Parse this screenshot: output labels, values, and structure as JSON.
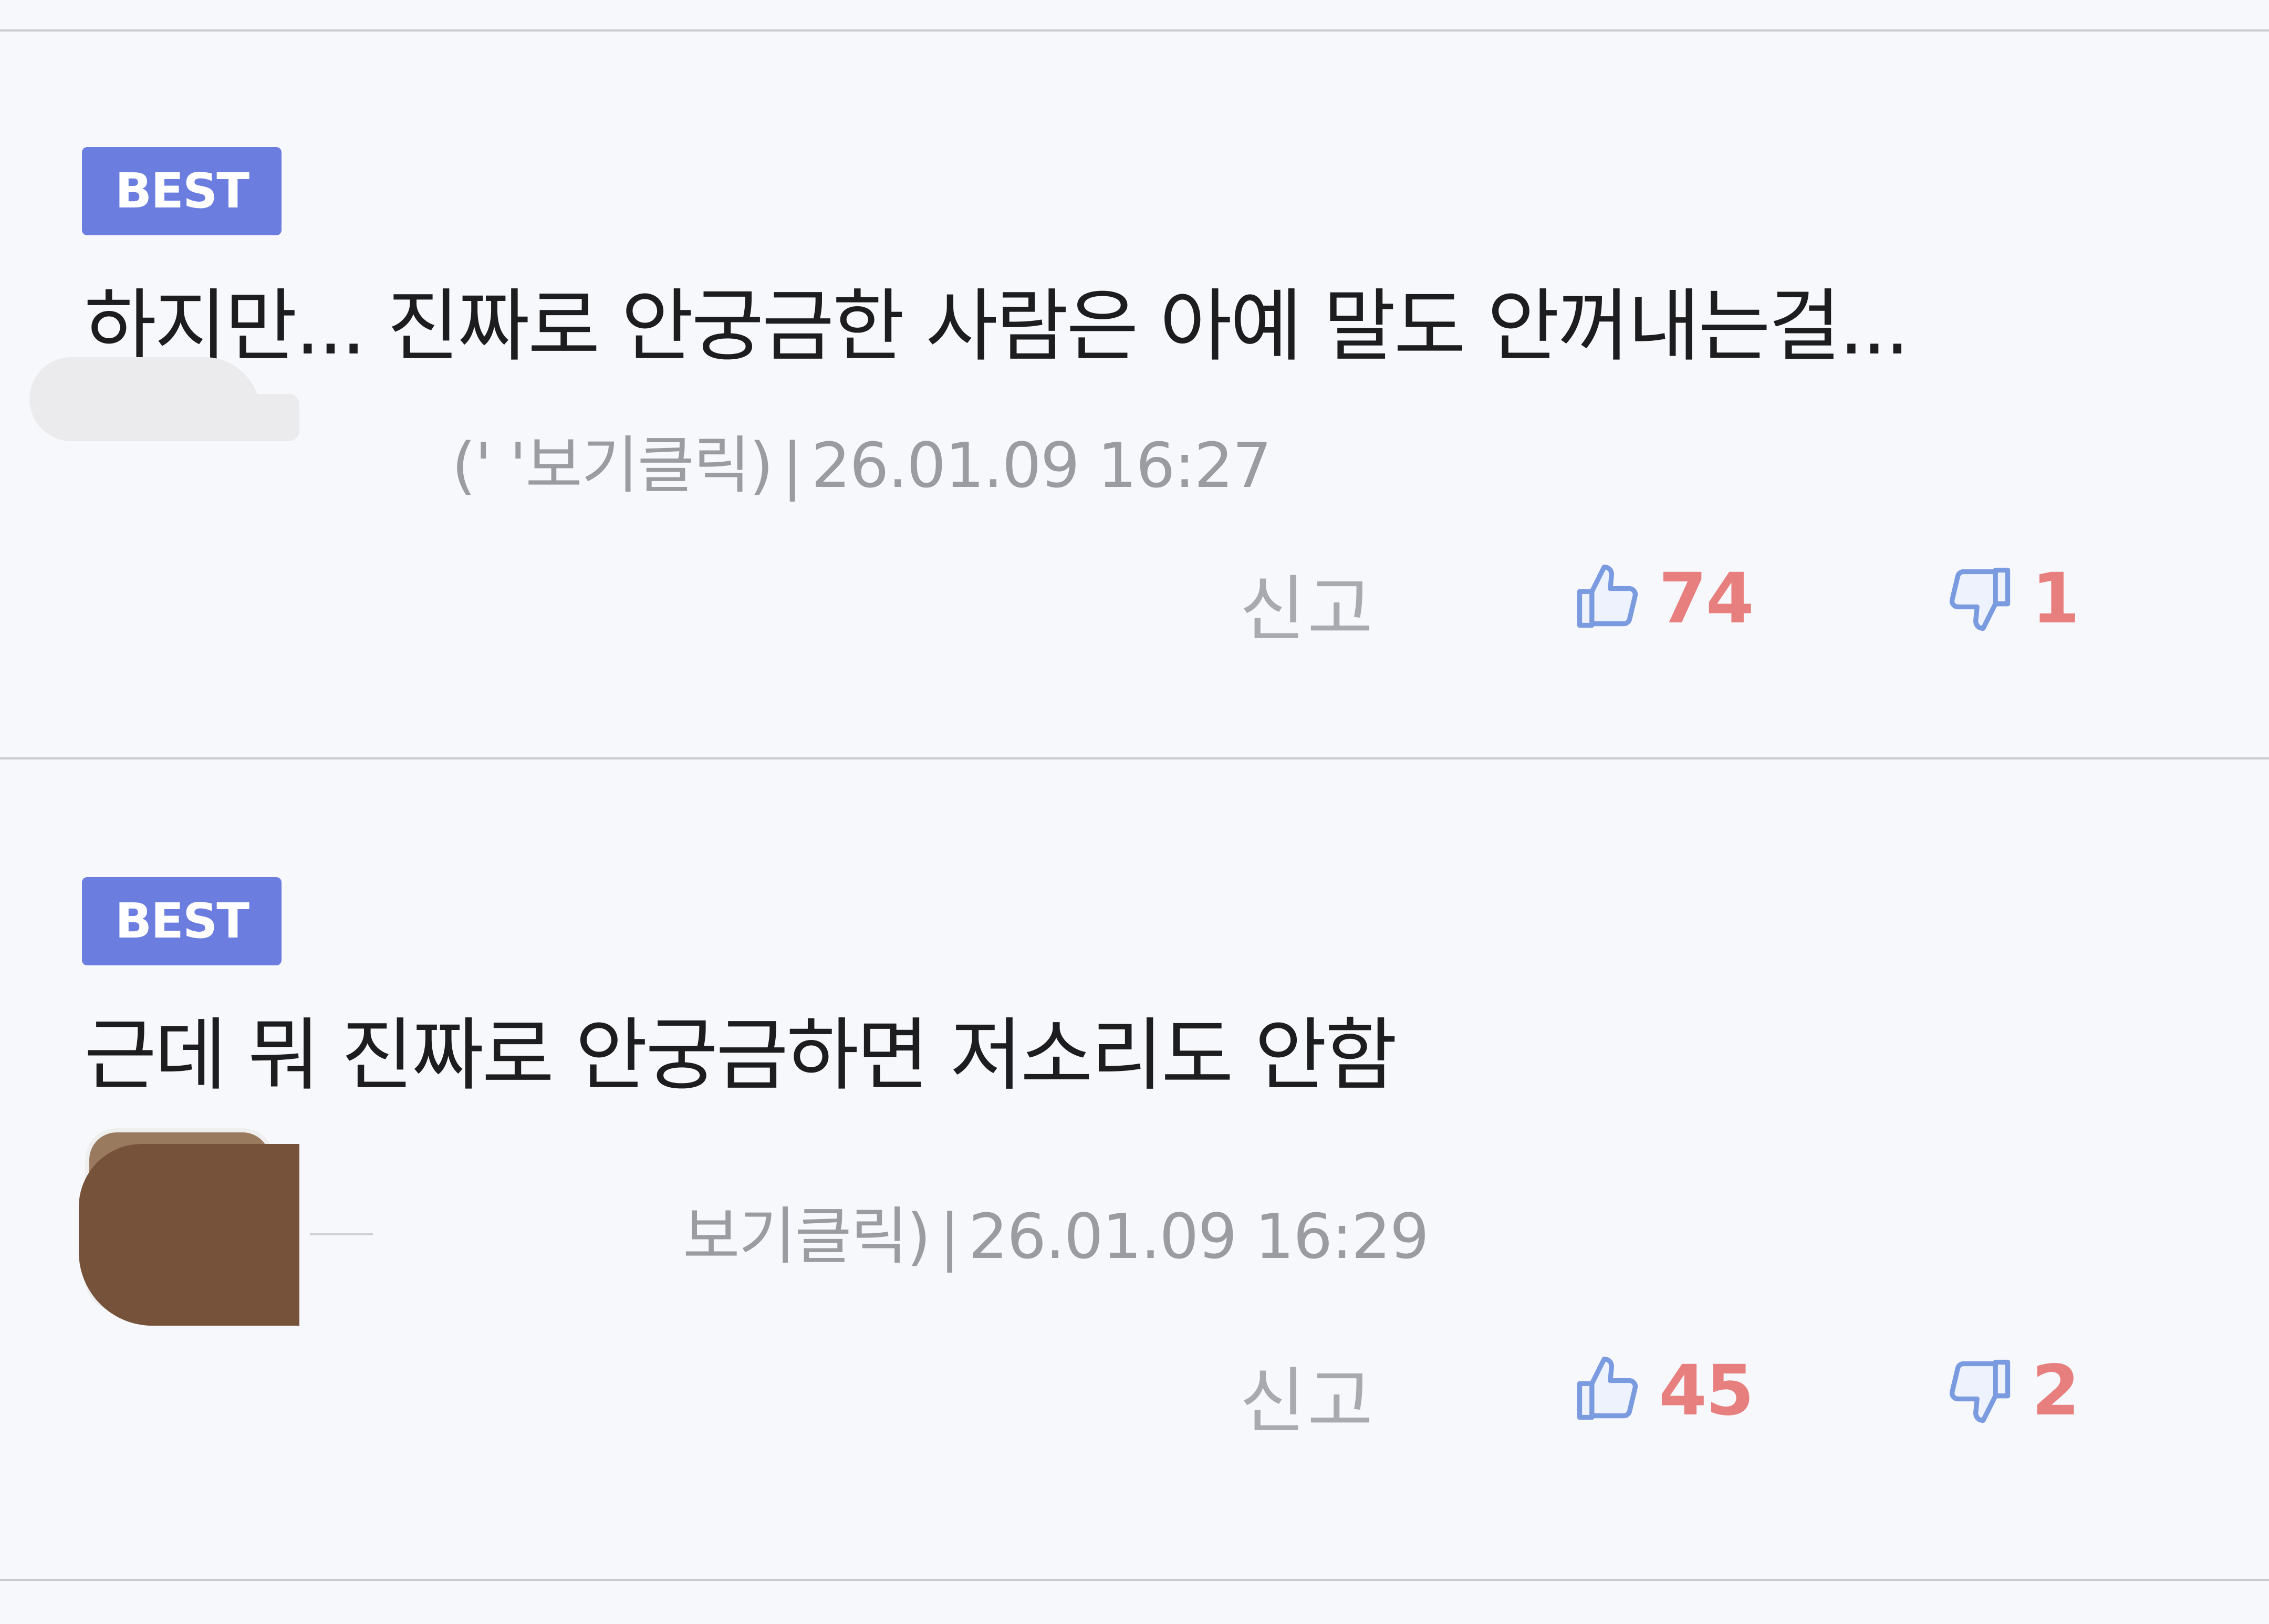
{
  "colors": {
    "badge_bg": "#6c7de0",
    "vote_count": "#e87f7f",
    "thumb_icon": "#7b9be0",
    "meta_text": "#9b9ca1",
    "background": "#f7f8fb",
    "divider": "#c9cbd0"
  },
  "comments": [
    {
      "badge": "BEST",
      "text": "하지만... 진짜로 안궁금한 사람은 아예 말도 안꺼내는걸...",
      "author_partial": "(' '보기클릭)",
      "timestamp": "26.01.09 16:27",
      "report_label": "신고",
      "likes": "74",
      "dislikes": "1",
      "like_icon": "thumbs-up-icon",
      "dislike_icon": "thumbs-down-icon"
    },
    {
      "badge": "BEST",
      "text": "근데 뭐 진짜로 안궁금하면 저소리도 안함",
      "author_partial": "보기클릭)",
      "timestamp": "26.01.09 16:29",
      "report_label": "신고",
      "likes": "45",
      "dislikes": "2",
      "like_icon": "thumbs-up-icon",
      "dislike_icon": "thumbs-down-icon"
    }
  ]
}
